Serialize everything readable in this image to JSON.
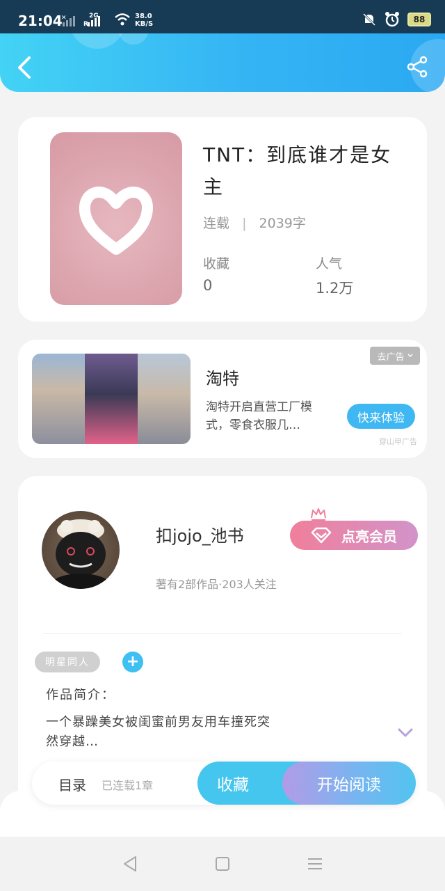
{
  "status_bar": {
    "time": "21:04",
    "speed_value": "38.0",
    "speed_unit": "KB/S",
    "net_2g": "2G",
    "net_r": "R",
    "battery": "88"
  },
  "header": {
    "back_icon": "chevron-left-icon",
    "share_icon": "share-icon"
  },
  "book": {
    "title": "TNT：到底谁才是女主",
    "status": "连载",
    "separator": "|",
    "word_count": "2039字",
    "favorites_label": "收藏",
    "favorites_value": "0",
    "popularity_label": "人气",
    "popularity_value": "1.2万"
  },
  "ad": {
    "title": "淘特",
    "description": "淘特开启直营工厂模式，零食衣服几…",
    "close_label": "去广告",
    "cta_label": "快来体验",
    "source": "穿山甲广告"
  },
  "author": {
    "name": "扣jojo_池书",
    "subtitle": "著有2部作品·203人关注",
    "vip_label": "点亮会员",
    "tag": "明星同人",
    "add_tag": "+",
    "intro_label": "作品简介：",
    "intro_text": "一个暴躁美女被闺蜜前男友用车撞死突然穿越…"
  },
  "bottom_bar": {
    "toc_label": "目录",
    "toc_sub": "已连载1章",
    "favorite_label": "收藏",
    "read_label": "开始阅读"
  },
  "colors": {
    "header_start": "#43d3f5",
    "header_end": "#2aa9f2",
    "accent_blue": "#3eb7f2",
    "vip_pink": "#f07f9b",
    "vip_purple": "#d293c9"
  }
}
